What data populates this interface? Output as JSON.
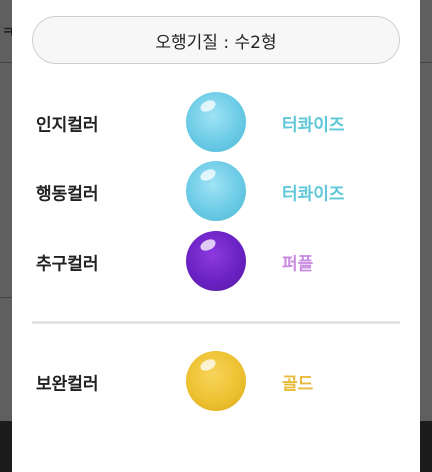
{
  "background": {
    "left_glyph": "ㅋ"
  },
  "header": {
    "pill_text": "오행기질 : 수2형"
  },
  "rows": [
    {
      "label": "인지컬러",
      "value": "터콰이즈",
      "color": "#5ec8d8"
    },
    {
      "label": "행동컬러",
      "value": "터콰이즈",
      "color": "#5ec8d8"
    },
    {
      "label": "추구컬러",
      "value": "퍼플",
      "color": "#c98ae0"
    },
    {
      "label": "보완컬러",
      "value": "골드",
      "color": "#e8b93a"
    }
  ]
}
